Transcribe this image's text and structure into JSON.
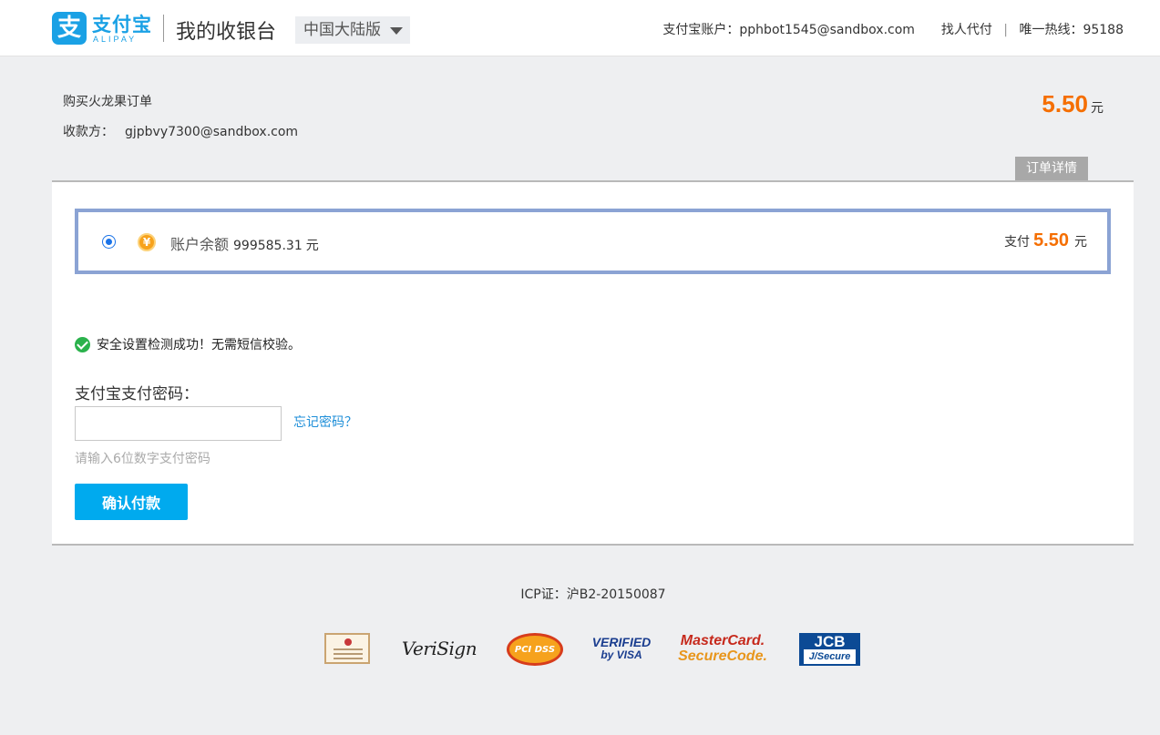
{
  "header": {
    "logo_cn": "支付宝",
    "logo_en": "ALIPAY",
    "logo_mark": "支",
    "site_title": "我的收银台",
    "region": "中国大陆版",
    "account_label": "支付宝账户：",
    "account_email": "pphbot1545@sandbox.com",
    "find_proxy_pay": "找人代付",
    "separator": "|",
    "hotline_label": "唯一热线：",
    "hotline_number": "95188"
  },
  "order": {
    "title": "购买火龙果订单",
    "payee_label": "收款方：",
    "payee_email": "gjpbvy7300@sandbox.com",
    "amount": "5.50",
    "currency_unit": "元",
    "detail_button": "订单详情"
  },
  "payment_method": {
    "selected": true,
    "yen_symbol": "¥",
    "balance_label": "账户余额",
    "balance_amount": "999585.31",
    "balance_unit": "元",
    "pay_label": "支付",
    "pay_amount": "5.50",
    "pay_unit": "元"
  },
  "security": {
    "message": "安全设置检测成功！无需短信校验。"
  },
  "password": {
    "label": "支付宝支付密码：",
    "value": "",
    "placeholder": "",
    "forgot_link": "忘记密码？",
    "hint": "请输入6位数字支付密码"
  },
  "confirm_button": "确认付款",
  "footer": {
    "icp": "ICP证：沪B2-20150087",
    "badges": {
      "verisign": "VeriSign",
      "pcidss": "PCI DSS",
      "visa_line1": "VERIFIED",
      "visa_line2": "by VISA",
      "mastercard_line1": "MasterCard.",
      "mastercard_line2": "SecureCode.",
      "jcb_line1": "JCB",
      "jcb_line2": "J/Secure"
    }
  },
  "colors": {
    "brand_blue": "#1aa1e5",
    "amount_orange": "#f56e00",
    "button_blue": "#00aaee",
    "method_border": "#8ba3d4",
    "success_green": "#2bb24c",
    "link_blue": "#1d8ed8"
  }
}
